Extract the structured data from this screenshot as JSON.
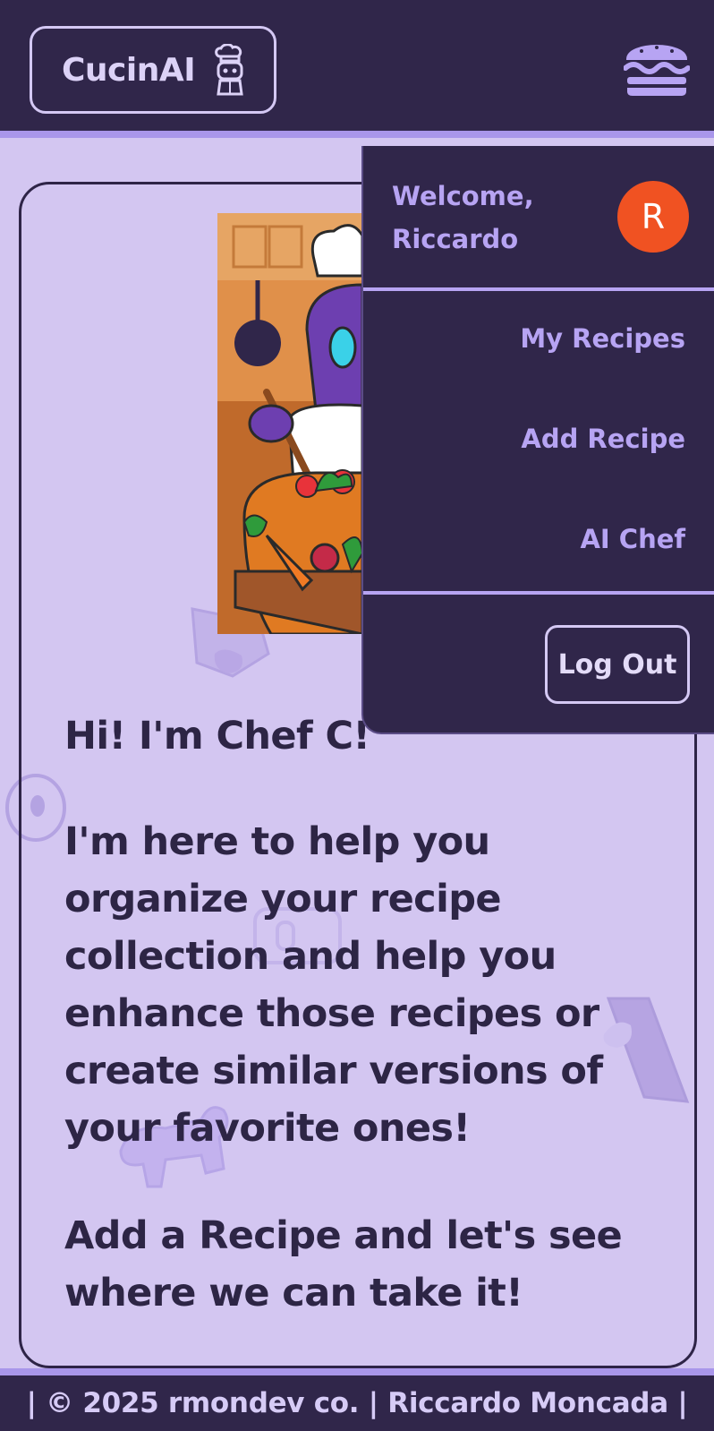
{
  "header": {
    "logo_text": "CucinAI",
    "logo_icon": "chef-robot-icon",
    "menu_icon": "burger-menu-icon"
  },
  "main": {
    "greeting": "Hi! I'm Chef C!",
    "intro": "I'm here to help you organize your recipe collection and help you enhance those recipes or create similar versions of your favorite ones!",
    "cta": "Add a Recipe and let's see where we can take it!"
  },
  "menu": {
    "welcome_line1": "Welcome,",
    "welcome_line2": "Riccardo",
    "avatar_initial": "R",
    "items": [
      {
        "label": "My Recipes"
      },
      {
        "label": "Add Recipe"
      },
      {
        "label": "AI Chef"
      }
    ],
    "logout_label": "Log Out"
  },
  "footer": {
    "text": "| © 2025 rmondev co. | Riccardo Moncada |"
  },
  "colors": {
    "background": "#d3c6f1",
    "header": "#30264a",
    "accent": "#a996ea",
    "avatar": "#f05222"
  }
}
